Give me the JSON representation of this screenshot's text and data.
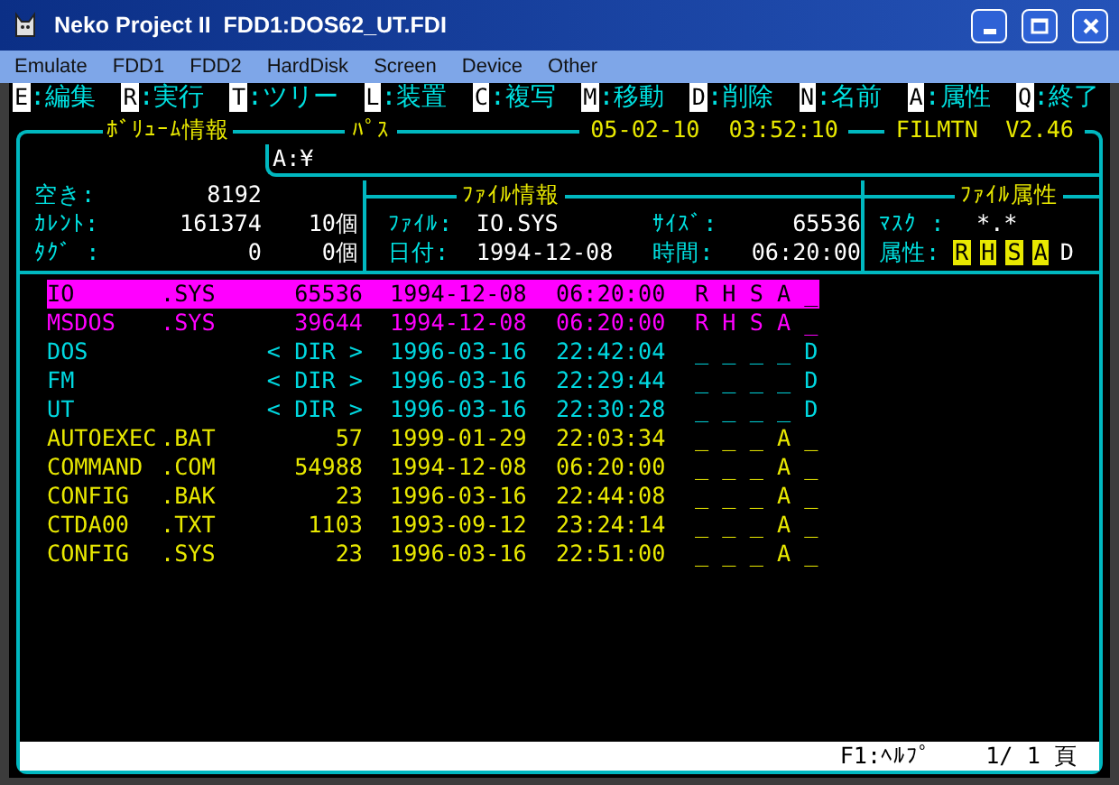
{
  "window": {
    "title": "Neko Project II  FDD1:DOS62_UT.FDI"
  },
  "menu": [
    "Emulate",
    "FDD1",
    "FDD2",
    "HardDisk",
    "Screen",
    "Device",
    "Other"
  ],
  "commands": [
    {
      "key": "E",
      "label": ":編集"
    },
    {
      "key": "R",
      "label": ":実行"
    },
    {
      "key": "T",
      "label": ":ツリー"
    },
    {
      "key": "L",
      "label": ":装置"
    },
    {
      "key": "C",
      "label": ":複写"
    },
    {
      "key": "M",
      "label": ":移動"
    },
    {
      "key": "D",
      "label": ":削除"
    },
    {
      "key": "N",
      "label": ":名前"
    },
    {
      "key": "A",
      "label": ":属性"
    },
    {
      "key": "Q",
      "label": ":終了"
    }
  ],
  "header": {
    "volume_title": "ﾎﾞﾘｭｰﾑ情報",
    "path_title": "ﾊﾟｽ",
    "date": "05-02-10",
    "time": "03:52:10",
    "app": "FILMTN  V2.46",
    "path": "A:¥"
  },
  "volume": [
    {
      "label": "空き:",
      "value": "8192"
    },
    {
      "label": "ｶﾚﾝﾄ:",
      "value": "161374",
      "count": "10個"
    },
    {
      "label": "ﾀｸﾞ :",
      "value": "0",
      "count": "0個"
    }
  ],
  "file_info": {
    "title": "ﾌｧｲﾙ情報",
    "rows": [
      [
        {
          "label": "ﾌｧｲﾙ:",
          "value": "IO.SYS"
        },
        {
          "label": "ｻｲｽﾞ:",
          "value": "65536"
        }
      ],
      [
        {
          "label": "日付:",
          "value": "1994-12-08"
        },
        {
          "label": "時間:",
          "value": "06:20:00"
        }
      ]
    ]
  },
  "attributes": {
    "title": "ﾌｧｲﾙ属性",
    "mask_label": "ﾏｽｸ :",
    "mask": "*.*",
    "attr_label": "属性:",
    "flags": [
      {
        "letter": "R",
        "on": true
      },
      {
        "letter": "H",
        "on": true
      },
      {
        "letter": "S",
        "on": true
      },
      {
        "letter": "A",
        "on": true
      },
      {
        "letter": "D",
        "on": false
      }
    ]
  },
  "files": [
    {
      "kind": "system",
      "selected": true,
      "name": "IO",
      "ext": ".SYS",
      "size": "65536",
      "date": "1994-12-08",
      "time": "06:20:00",
      "attrs": "R H S A _"
    },
    {
      "kind": "system",
      "selected": false,
      "name": "MSDOS",
      "ext": ".SYS",
      "size": "39644",
      "date": "1994-12-08",
      "time": "06:20:00",
      "attrs": "R H S A _"
    },
    {
      "kind": "dir",
      "selected": false,
      "name": "DOS",
      "size": "< DIR >",
      "date": "1996-03-16",
      "time": "22:42:04",
      "attrs": "_ _ _ _ D"
    },
    {
      "kind": "dir",
      "selected": false,
      "name": "FM",
      "size": "< DIR >",
      "date": "1996-03-16",
      "time": "22:29:44",
      "attrs": "_ _ _ _ D"
    },
    {
      "kind": "dir",
      "selected": false,
      "name": "UT",
      "size": "< DIR >",
      "date": "1996-03-16",
      "time": "22:30:28",
      "attrs": "_ _ _ _ D"
    },
    {
      "kind": "file",
      "selected": false,
      "name": "AUTOEXEC",
      "ext": ".BAT",
      "size": "57",
      "date": "1999-01-29",
      "time": "22:03:34",
      "attrs": "_ _ _ A _"
    },
    {
      "kind": "file",
      "selected": false,
      "name": "COMMAND",
      "ext": ".COM",
      "size": "54988",
      "date": "1994-12-08",
      "time": "06:20:00",
      "attrs": "_ _ _ A _"
    },
    {
      "kind": "file",
      "selected": false,
      "name": "CONFIG",
      "ext": ".BAK",
      "size": "23",
      "date": "1996-03-16",
      "time": "22:44:08",
      "attrs": "_ _ _ A _"
    },
    {
      "kind": "file",
      "selected": false,
      "name": "CTDA00",
      "ext": ".TXT",
      "size": "1103",
      "date": "1993-09-12",
      "time": "23:24:14",
      "attrs": "_ _ _ A _"
    },
    {
      "kind": "file",
      "selected": false,
      "name": "CONFIG",
      "ext": ".SYS",
      "size": "23",
      "date": "1996-03-16",
      "time": "22:51:00",
      "attrs": "_ _ _ A _"
    }
  ],
  "status": {
    "help": "F1:ﾍﾙﾌﾟ",
    "page": "1/ 1 頁"
  }
}
